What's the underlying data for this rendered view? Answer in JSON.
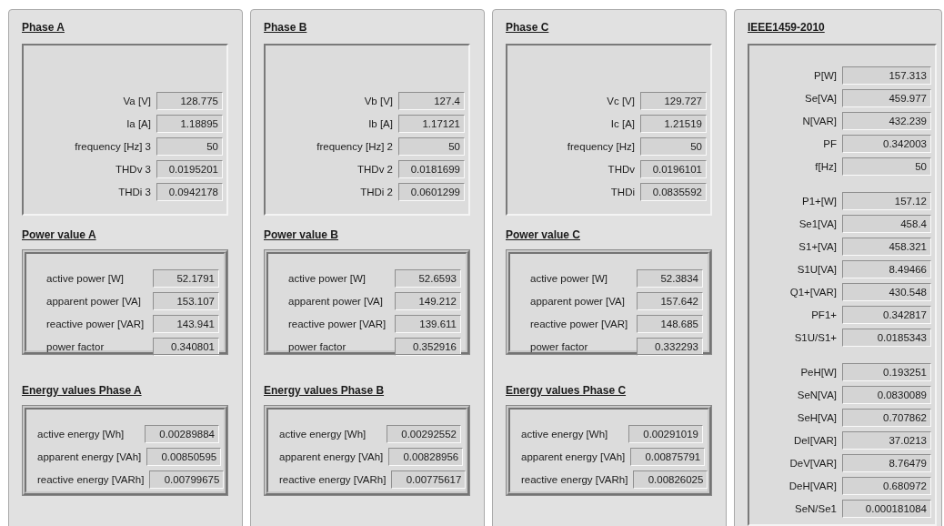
{
  "phases": [
    {
      "title": "Phase A",
      "readings": [
        {
          "label": "Va [V]",
          "value": "128.775"
        },
        {
          "label": "Ia [A]",
          "value": "1.18895"
        },
        {
          "label": "frequency [Hz] 3",
          "value": "50"
        },
        {
          "label": "THDv 3",
          "value": "0.0195201"
        },
        {
          "label": "THDi 3",
          "value": "0.0942178"
        }
      ],
      "power_title": "Power value A",
      "power": [
        {
          "label": "active power [W]",
          "value": "52.1791"
        },
        {
          "label": "apparent power [VA]",
          "value": "153.107"
        },
        {
          "label": "reactive power [VAR]",
          "value": "143.941"
        },
        {
          "label": "power factor",
          "value": "0.340801"
        }
      ],
      "energy_title": "Energy values Phase A",
      "energy": [
        {
          "label": "active energy [Wh]",
          "value": "0.00289884"
        },
        {
          "label": "apparent energy [VAh]",
          "value": "0.00850595"
        },
        {
          "label": "reactive energy [VARh]",
          "value": "0.00799675"
        }
      ]
    },
    {
      "title": "Phase B",
      "readings": [
        {
          "label": "Vb [V]",
          "value": "127.4"
        },
        {
          "label": "Ib [A]",
          "value": "1.17121"
        },
        {
          "label": "frequency [Hz] 2",
          "value": "50"
        },
        {
          "label": "THDv 2",
          "value": "0.0181699"
        },
        {
          "label": "THDi 2",
          "value": "0.0601299"
        }
      ],
      "power_title": "Power value B",
      "power": [
        {
          "label": "active power [W]",
          "value": "52.6593"
        },
        {
          "label": "apparent power [VA]",
          "value": "149.212"
        },
        {
          "label": "reactive power [VAR]",
          "value": "139.611"
        },
        {
          "label": "power factor",
          "value": "0.352916"
        }
      ],
      "energy_title": "Energy values Phase B",
      "energy": [
        {
          "label": "active energy [Wh]",
          "value": "0.00292552"
        },
        {
          "label": "apparent energy [VAh]",
          "value": "0.00828956"
        },
        {
          "label": "reactive energy [VARh]",
          "value": "0.00775617"
        }
      ]
    },
    {
      "title": "Phase C",
      "readings": [
        {
          "label": "Vc [V]",
          "value": "129.727"
        },
        {
          "label": "Ic [A]",
          "value": "1.21519"
        },
        {
          "label": "frequency [Hz]",
          "value": "50"
        },
        {
          "label": "THDv",
          "value": "0.0196101"
        },
        {
          "label": "THDi",
          "value": "0.0835592"
        }
      ],
      "power_title": "Power value C",
      "power": [
        {
          "label": "active power [W]",
          "value": "52.3834"
        },
        {
          "label": "apparent power [VA]",
          "value": "157.642"
        },
        {
          "label": "reactive power [VAR]",
          "value": "148.685"
        },
        {
          "label": "power factor",
          "value": "0.332293"
        }
      ],
      "energy_title": "Energy values Phase C",
      "energy": [
        {
          "label": "active energy [Wh]",
          "value": "0.00291019"
        },
        {
          "label": "apparent energy [VAh]",
          "value": "0.00875791"
        },
        {
          "label": "reactive energy [VARh]",
          "value": "0.00826025"
        }
      ]
    }
  ],
  "ieee": {
    "title": "IEEE1459-2010",
    "groups": [
      [
        {
          "label": "P[W]",
          "value": "157.313"
        },
        {
          "label": "Se[VA]",
          "value": "459.977"
        },
        {
          "label": "N[VAR]",
          "value": "432.239"
        },
        {
          "label": "PF",
          "value": "0.342003"
        },
        {
          "label": "f[Hz]",
          "value": "50"
        }
      ],
      [
        {
          "label": "P1+[W]",
          "value": "157.12"
        },
        {
          "label": "Se1[VA]",
          "value": "458.4"
        },
        {
          "label": "S1+[VA]",
          "value": "458.321"
        },
        {
          "label": "S1U[VA]",
          "value": "8.49466"
        },
        {
          "label": "Q1+[VAR]",
          "value": "430.548"
        },
        {
          "label": "PF1+",
          "value": "0.342817"
        },
        {
          "label": "S1U/S1+",
          "value": "0.0185343"
        }
      ],
      [
        {
          "label": "PeH[W]",
          "value": "0.193251"
        },
        {
          "label": "SeN[VA]",
          "value": "0.0830089"
        },
        {
          "label": "SeH[VA]",
          "value": "0.707862"
        },
        {
          "label": "DeI[VAR]",
          "value": "37.0213"
        },
        {
          "label": "DeV[VAR]",
          "value": "8.76479"
        },
        {
          "label": "DeH[VAR]",
          "value": "0.680972"
        },
        {
          "label": "SeN/Se1",
          "value": "0.000181084"
        }
      ]
    ]
  }
}
